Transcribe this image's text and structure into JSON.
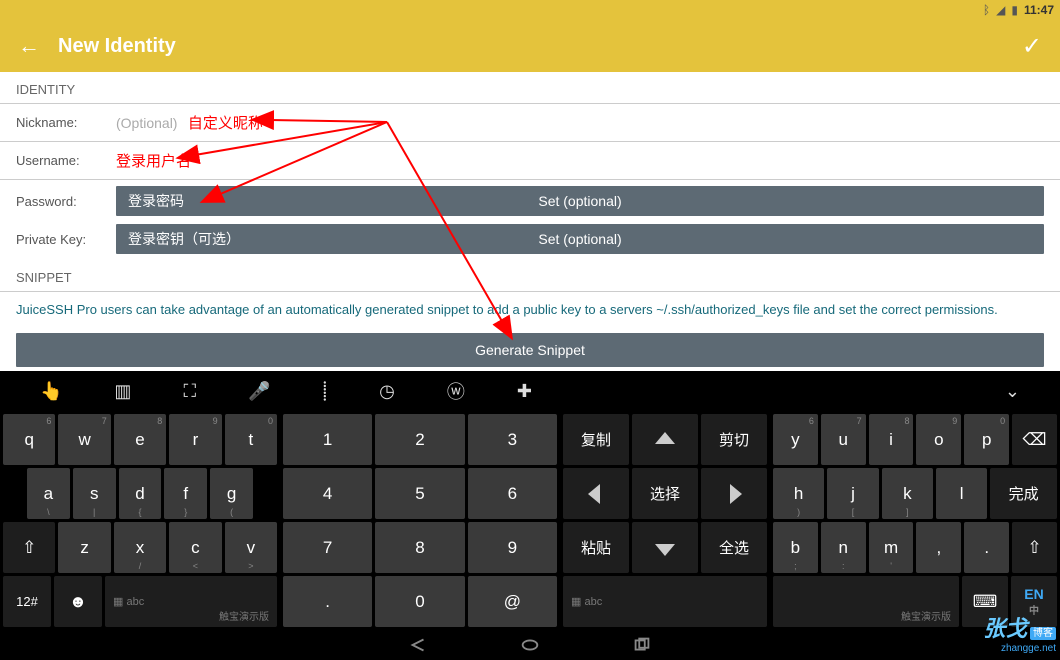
{
  "status": {
    "time": "11:47"
  },
  "appbar": {
    "title": "New Identity"
  },
  "sections": {
    "identity": "IDENTITY",
    "snippet": "SNIPPET"
  },
  "fields": {
    "nickname": {
      "label": "Nickname:",
      "placeholder": "(Optional)",
      "annot": "自定义昵称"
    },
    "username": {
      "label": "Username:",
      "annot": "登录用户名"
    },
    "password": {
      "label": "Password:",
      "left": "登录密码",
      "center": "Set (optional)"
    },
    "privatekey": {
      "label": "Private Key:",
      "left": "登录密钥（可选）",
      "center": "Set (optional)"
    }
  },
  "snippet": {
    "desc": "JuiceSSH Pro users can take advantage of an automatically generated snippet to add a public key to a servers ~/.ssh/authorized_keys file and set the correct permissions.",
    "button": "Generate Snippet"
  },
  "keyboard": {
    "qwerty_top": [
      "q",
      "w",
      "e",
      "r",
      "t"
    ],
    "qwerty_top_sup": [
      "6",
      "7",
      "8",
      "9",
      "0"
    ],
    "qwerty_mid": [
      "a",
      "s",
      "d",
      "f",
      "g"
    ],
    "qwerty_mid_sub": [
      "\\",
      "|",
      "{",
      "}",
      "("
    ],
    "qwerty_bot": [
      "z",
      "x",
      "c",
      "v"
    ],
    "qwerty_bot_sub": [
      "",
      "/",
      "<",
      ">"
    ],
    "num_top": [
      "1",
      "2",
      "3"
    ],
    "num_mid": [
      "4",
      "5",
      "6"
    ],
    "num_bot": [
      "7",
      "8",
      "9"
    ],
    "num_last": [
      ".",
      "0",
      "@"
    ],
    "cn": {
      "copy": "复制",
      "cut": "剪切",
      "select": "选择",
      "paste": "粘贴",
      "all": "全选"
    },
    "right_top": [
      "y",
      "u",
      "i",
      "o",
      "p"
    ],
    "right_top_sup": [
      "6",
      "7",
      "8",
      "9",
      "0"
    ],
    "right_mid": [
      "h",
      "j",
      "k",
      "l"
    ],
    "right_mid_sub": [
      ")",
      "[",
      "]",
      ""
    ],
    "right_done": "完成",
    "right_bot": [
      "b",
      "n",
      "m"
    ],
    "right_bot_sub": [
      ";",
      ":",
      "'"
    ],
    "mode": "12#",
    "abc": "abc",
    "demo": "触宝演示版",
    "en": "EN",
    "zh": "中"
  },
  "watermark": {
    "name": "张戈",
    "site": "zhangge.net",
    "tag": "博客"
  }
}
